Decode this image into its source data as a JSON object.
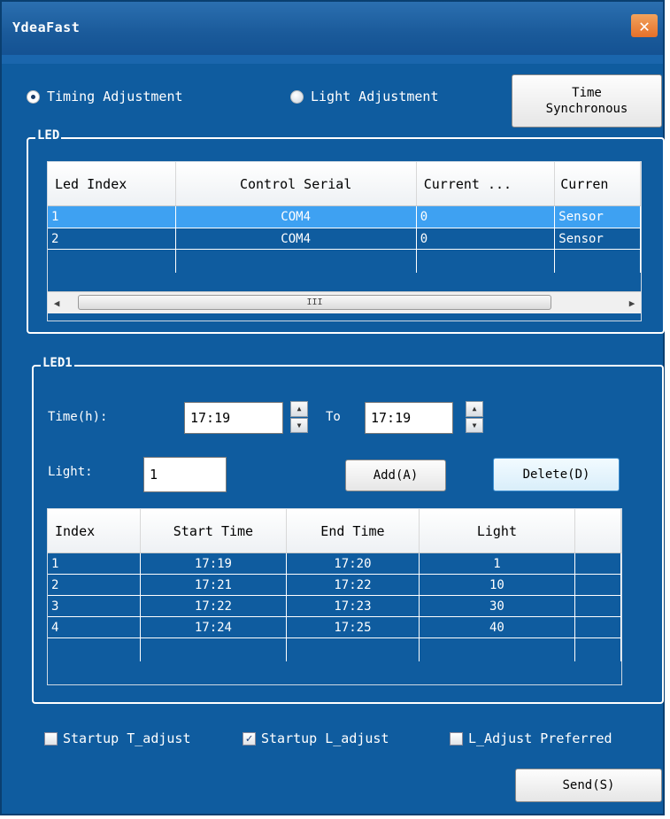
{
  "window": {
    "title": "YdeaFast",
    "close_glyph": "✕"
  },
  "mode": {
    "timing_label": "Timing Adjustment",
    "light_label": "Light Adjustment",
    "selected": "timing",
    "time_sync_line1": "Time",
    "time_sync_line2": "Synchronous"
  },
  "led_group": {
    "label": "LED",
    "columns": [
      "Led Index",
      "Control Serial",
      "Current ...",
      "Curren"
    ],
    "rows": [
      [
        "1",
        "COM4",
        "0",
        "Sensor"
      ],
      [
        "2",
        "COM4",
        "0",
        "Sensor"
      ],
      [
        "",
        "",
        "",
        ""
      ]
    ],
    "scroll_left": "◀",
    "scroll_right": "▶",
    "scroll_thumb": "III"
  },
  "led1_group": {
    "label": "LED1",
    "time_label": "Time(h):",
    "from_value": "17:19",
    "to_label": "To",
    "to_value": "17:19",
    "light_label": "Light:",
    "light_value": "1",
    "add_label": "Add(A)",
    "delete_label": "Delete(D)",
    "columns": [
      "Index",
      "Start Time",
      "End Time",
      "Light",
      ""
    ],
    "rows": [
      [
        "1",
        "17:19",
        "17:20",
        "1",
        ""
      ],
      [
        "2",
        "17:21",
        "17:22",
        "10",
        ""
      ],
      [
        "3",
        "17:22",
        "17:23",
        "30",
        ""
      ],
      [
        "4",
        "17:24",
        "17:25",
        "40",
        ""
      ],
      [
        "",
        "",
        "",
        "",
        ""
      ]
    ]
  },
  "options": {
    "startup_t": "Startup T_adjust",
    "startup_t_checked": false,
    "startup_l": "Startup L_adjust",
    "startup_l_checked": true,
    "l_preferred": "L_Adjust Preferred",
    "l_preferred_checked": false,
    "check_glyph": "✓"
  },
  "send_label": "Send(S)",
  "spin_up": "▲",
  "spin_down": "▼"
}
